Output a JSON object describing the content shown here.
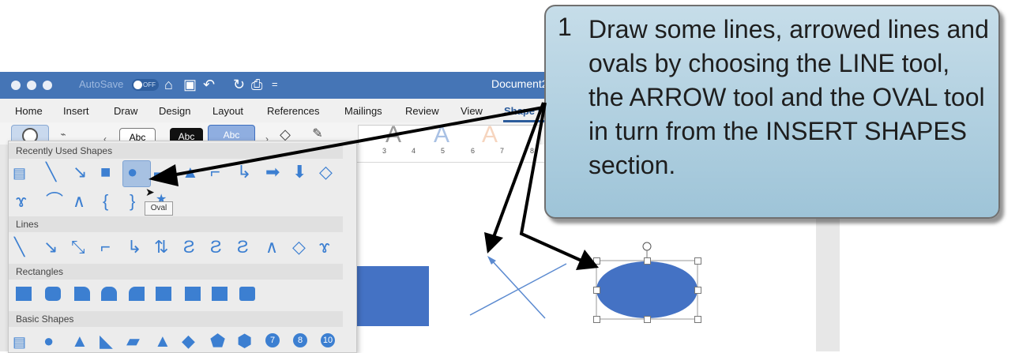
{
  "titlebar": {
    "autosave_label": "AutoSave",
    "autosave_state": "OFF",
    "doc_title": "Document2"
  },
  "menu": {
    "tabs": [
      "Home",
      "Insert",
      "Draw",
      "Design",
      "Layout",
      "References",
      "Mailings",
      "Review",
      "View",
      "Shape Format"
    ]
  },
  "ribbon": {
    "style_labels": [
      "Abc",
      "Abc",
      "Abc"
    ],
    "wordart_letters": [
      "A",
      "A",
      "A"
    ]
  },
  "gallery": {
    "sections": [
      "Recently Used Shapes",
      "Lines",
      "Rectangles",
      "Basic Shapes"
    ],
    "tooltip": "Oval",
    "basic_numbers": [
      "7",
      "8",
      "10"
    ]
  },
  "ruler": {
    "numbers": [
      "3",
      "4",
      "5",
      "6",
      "7",
      "8"
    ]
  },
  "callout": {
    "number": "1",
    "text_parts": [
      "Draw some lines, arrowed lines and ",
      "ovals by choosing the",
      " LINE tool, the ARROW tool and the OVAL tool in turn from the INSERT SHAPES section."
    ]
  },
  "colors": {
    "titlebar": "#4575b6",
    "shape_blue": "#4472c4",
    "gallery_blue": "#3c7fd1",
    "callout_top": "#c6dde9",
    "callout_bottom": "#9ec4d8"
  }
}
